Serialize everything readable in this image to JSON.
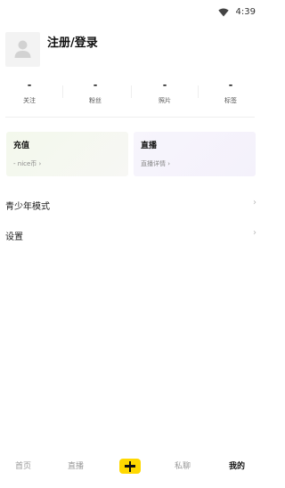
{
  "status_bar": {
    "time": "4:39",
    "icons": [
      "wifi-icon"
    ]
  },
  "profile": {
    "login_label": "注册/登录",
    "avatar_icon": "user-avatar-icon"
  },
  "stats": [
    {
      "value": "-",
      "label": "关注"
    },
    {
      "value": "-",
      "label": "粉丝"
    },
    {
      "value": "-",
      "label": "照片"
    },
    {
      "value": "-",
      "label": "标签"
    }
  ],
  "cards": {
    "recharge": {
      "title": "充值",
      "subtitle": "- nice币 ›"
    },
    "live": {
      "title": "直播",
      "subtitle": "直播详情 ›"
    }
  },
  "menu": {
    "teen_mode": "青少年模式",
    "settings": "设置",
    "chevron": "›"
  },
  "bottom_nav": {
    "home": "首页",
    "live": "直播",
    "messages": "私聊",
    "me": "我的",
    "active": "me",
    "add_icon": "plus-icon",
    "accent_color": "#ffd800"
  }
}
